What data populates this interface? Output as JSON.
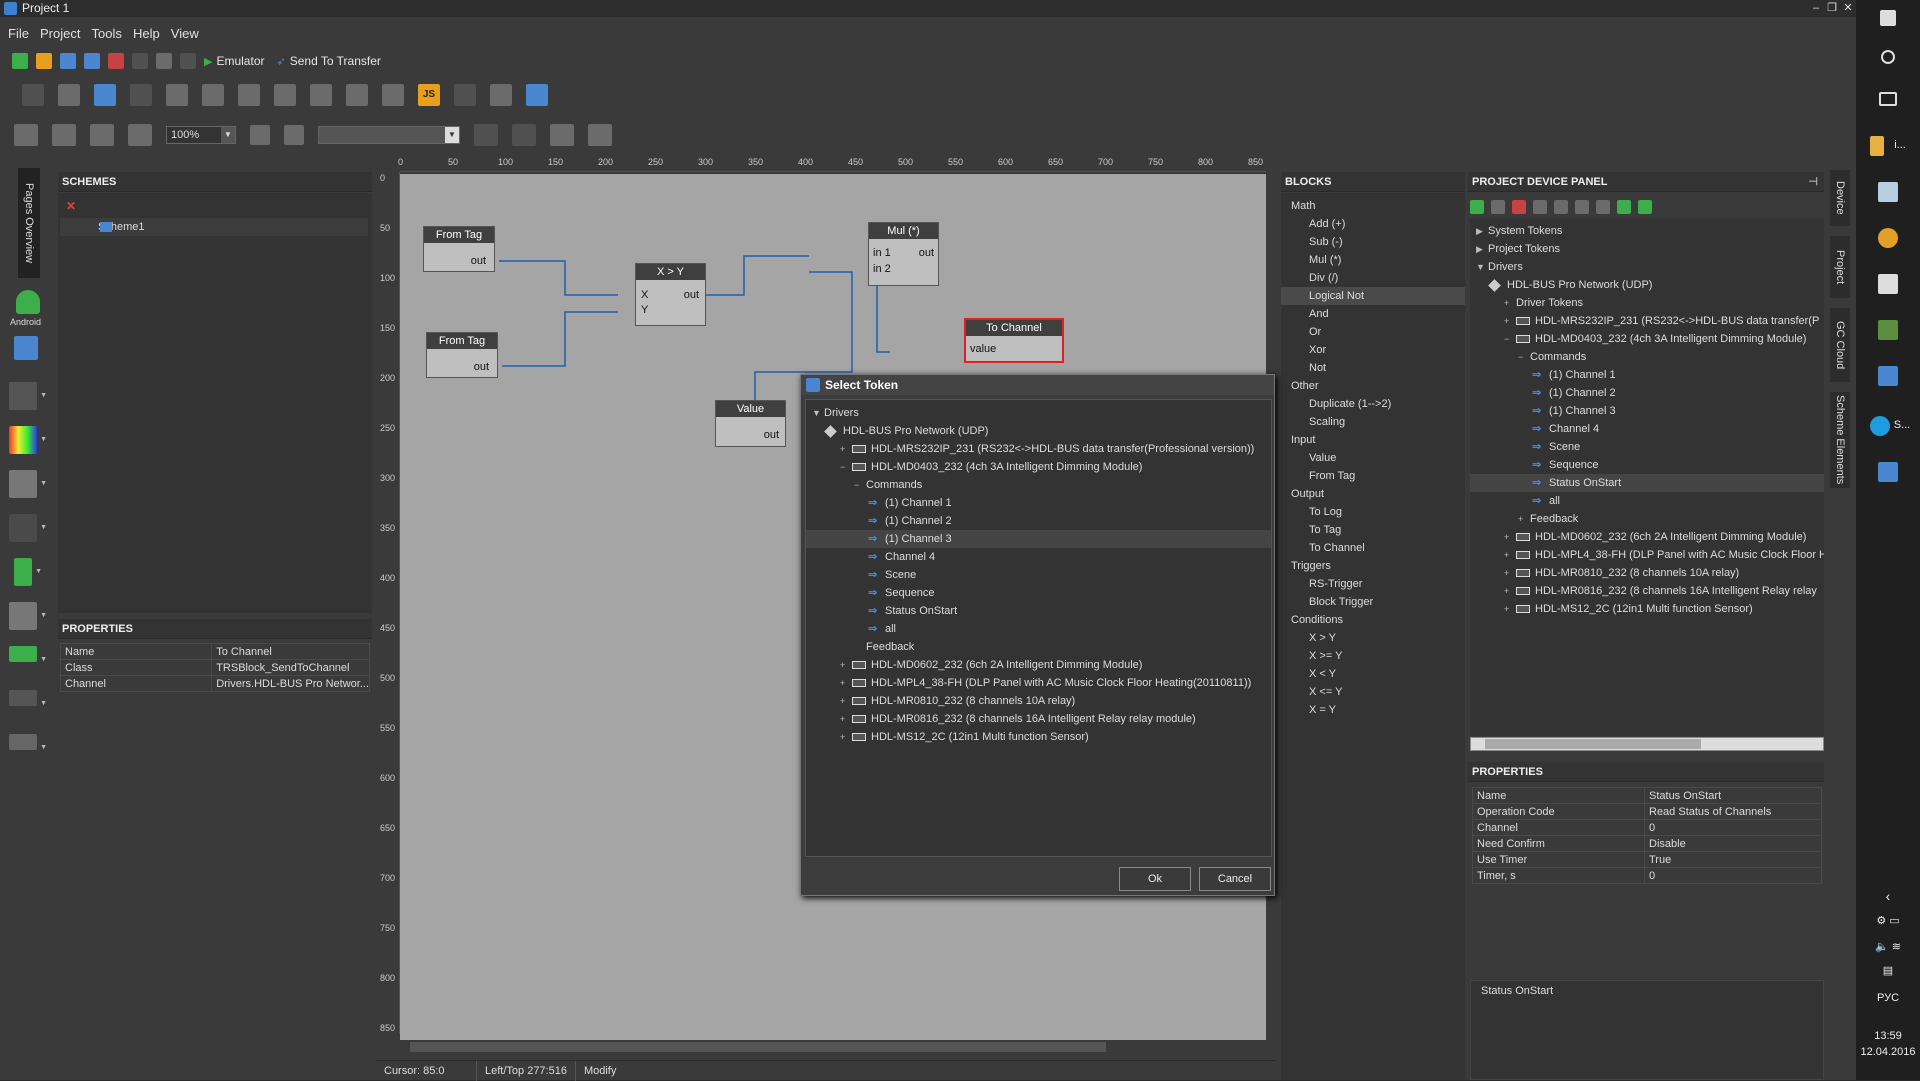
{
  "window": {
    "title": "Project 1"
  },
  "menu": [
    "File",
    "Project",
    "Tools",
    "Help",
    "View"
  ],
  "toolbar": {
    "emulator": "Emulator",
    "send_to_transfer": "Send To Transfer",
    "zoom": "100%",
    "js": "JS"
  },
  "left_tools": {
    "pages_overview": "Pages Overview",
    "android": "Android"
  },
  "schemes": {
    "title": "SCHEMES",
    "items": [
      "Scheme1"
    ]
  },
  "properties_left": {
    "title": "PROPERTIES",
    "rows": [
      {
        "k": "Name",
        "v": "To Channel"
      },
      {
        "k": "Class",
        "v": "TRSBlock_SendToChannel"
      },
      {
        "k": "Channel",
        "v": "Drivers.HDL-BUS Pro Networ..."
      }
    ]
  },
  "ruler": {
    "top": [
      "0",
      "50",
      "100",
      "150",
      "200",
      "250",
      "300",
      "350",
      "400",
      "450",
      "500",
      "550",
      "600",
      "650",
      "700",
      "750",
      "800",
      "850"
    ],
    "left": [
      "0",
      "50",
      "100",
      "150",
      "200",
      "250",
      "300",
      "350",
      "400",
      "450",
      "500",
      "550",
      "600",
      "650",
      "700",
      "750",
      "800",
      "850"
    ]
  },
  "canvas_blocks": {
    "from_tag_1": {
      "title": "From Tag",
      "out": "out"
    },
    "from_tag_2": {
      "title": "From Tag",
      "out": "out"
    },
    "compare": {
      "title": "X > Y",
      "x": "X",
      "y": "Y",
      "out": "out"
    },
    "mul": {
      "title": "Mul (*)",
      "in1": "in 1",
      "in2": "in 2",
      "out": "out"
    },
    "to_channel": {
      "title": "To Channel",
      "value": "value"
    },
    "value": {
      "title": "Value",
      "out": "out"
    }
  },
  "status": {
    "cursor": "Cursor: 85:0",
    "lefttop": "Left/Top 277:516",
    "mode": "Modify"
  },
  "blocks": {
    "title": "BLOCKS",
    "list": [
      {
        "t": "Math",
        "k": "cat"
      },
      {
        "t": "Add (+)",
        "k": "item"
      },
      {
        "t": "Sub (-)",
        "k": "item"
      },
      {
        "t": "Mul (*)",
        "k": "item"
      },
      {
        "t": "Div (/)",
        "k": "item"
      },
      {
        "t": "Logical Not",
        "k": "item"
      },
      {
        "t": "And",
        "k": "item"
      },
      {
        "t": "Or",
        "k": "item"
      },
      {
        "t": "Xor",
        "k": "item"
      },
      {
        "t": "Not",
        "k": "item"
      },
      {
        "t": "Other",
        "k": "cat"
      },
      {
        "t": "Duplicate (1-->2)",
        "k": "item"
      },
      {
        "t": "Scaling",
        "k": "item"
      },
      {
        "t": "Input",
        "k": "cat"
      },
      {
        "t": "Value",
        "k": "item"
      },
      {
        "t": "From Tag",
        "k": "item"
      },
      {
        "t": "Output",
        "k": "cat"
      },
      {
        "t": "To Log",
        "k": "item"
      },
      {
        "t": "To Tag",
        "k": "item"
      },
      {
        "t": "To Channel",
        "k": "item"
      },
      {
        "t": "Triggers",
        "k": "cat"
      },
      {
        "t": "RS-Trigger",
        "k": "item"
      },
      {
        "t": "Block Trigger",
        "k": "item"
      },
      {
        "t": "Conditions",
        "k": "cat"
      },
      {
        "t": "X > Y",
        "k": "item"
      },
      {
        "t": "X >= Y",
        "k": "item"
      },
      {
        "t": "X < Y",
        "k": "item"
      },
      {
        "t": "X <= Y",
        "k": "item"
      },
      {
        "t": "X = Y",
        "k": "item"
      }
    ]
  },
  "device_panel": {
    "title": "PROJECT DEVICE PANEL",
    "tree": [
      {
        "t": "System Tokens",
        "lvl": 1,
        "ic": "exp"
      },
      {
        "t": "Project Tokens",
        "lvl": 1,
        "ic": "exp"
      },
      {
        "t": "Drivers",
        "lvl": 1,
        "ic": "col"
      },
      {
        "t": "HDL-BUS Pro Network (UDP)",
        "lvl": 2,
        "ic": "dia"
      },
      {
        "t": "Driver Tokens",
        "lvl": 3,
        "ic": "plus"
      },
      {
        "t": "HDL-MRS232IP_231 (RS232<->HDL-BUS data transfer(P",
        "lvl": 3,
        "ic": "dev"
      },
      {
        "t": "HDL-MD0403_232 (4ch 3A Intelligent Dimming Module)",
        "lvl": 3,
        "ic": "devo"
      },
      {
        "t": "Commands",
        "lvl": 4,
        "ic": "minus"
      },
      {
        "t": "(1) Channel 1",
        "lvl": 5,
        "ic": "arr"
      },
      {
        "t": "(1) Channel 2",
        "lvl": 5,
        "ic": "arr"
      },
      {
        "t": "(1) Channel 3",
        "lvl": 5,
        "ic": "arr"
      },
      {
        "t": "Channel 4",
        "lvl": 5,
        "ic": "arr"
      },
      {
        "t": "Scene",
        "lvl": 5,
        "ic": "arr"
      },
      {
        "t": "Sequence",
        "lvl": 5,
        "ic": "arr"
      },
      {
        "t": "Status OnStart",
        "lvl": 5,
        "ic": "arr",
        "sel": true
      },
      {
        "t": "all",
        "lvl": 5,
        "ic": "arr"
      },
      {
        "t": "Feedback",
        "lvl": 4,
        "ic": "plus"
      },
      {
        "t": "HDL-MD0602_232 (6ch 2A Intelligent Dimming Module)",
        "lvl": 3,
        "ic": "dev"
      },
      {
        "t": "HDL-MPL4_38-FH (DLP Panel with AC Music Clock Floor H",
        "lvl": 3,
        "ic": "dev"
      },
      {
        "t": "HDL-MR0810_232 (8 channels 10A relay)",
        "lvl": 3,
        "ic": "dev"
      },
      {
        "t": "HDL-MR0816_232 (8 channels 16A Intelligent Relay relay",
        "lvl": 3,
        "ic": "dev"
      },
      {
        "t": "HDL-MS12_2C (12in1 Multi function Sensor)",
        "lvl": 3,
        "ic": "dev"
      }
    ]
  },
  "properties_right": {
    "title": "PROPERTIES",
    "rows": [
      {
        "k": "Name",
        "v": "Status OnStart"
      },
      {
        "k": "Operation Code",
        "v": "Read Status of Channels"
      },
      {
        "k": "Channel",
        "v": "0"
      },
      {
        "k": "Need Confirm",
        "v": "Disable"
      },
      {
        "k": "Use Timer",
        "v": "True"
      },
      {
        "k": "Timer, s",
        "v": "0"
      }
    ],
    "description": "Status OnStart"
  },
  "side_tabs": [
    "Device",
    "Project",
    "GC Cloud",
    "Scheme Elements"
  ],
  "dialog": {
    "title": "Select Token",
    "tree": [
      {
        "t": "Drivers",
        "lvl": 1,
        "ic": "col"
      },
      {
        "t": "HDL-BUS Pro Network (UDP)",
        "lvl": 2,
        "ic": "dia"
      },
      {
        "t": "HDL-MRS232IP_231 (RS232<->HDL-BUS data transfer(Professional version))",
        "lvl": 3,
        "ic": "dev"
      },
      {
        "t": "HDL-MD0403_232 (4ch 3A Intelligent Dimming Module)",
        "lvl": 3,
        "ic": "devo"
      },
      {
        "t": "Commands",
        "lvl": 4,
        "ic": "minus"
      },
      {
        "t": "(1) Channel 1",
        "lvl": 5,
        "ic": "arr"
      },
      {
        "t": "(1) Channel 2",
        "lvl": 5,
        "ic": "arr"
      },
      {
        "t": "(1) Channel 3",
        "lvl": 5,
        "ic": "arr",
        "sel": true
      },
      {
        "t": "Channel 4",
        "lvl": 5,
        "ic": "arr"
      },
      {
        "t": "Scene",
        "lvl": 5,
        "ic": "arr"
      },
      {
        "t": "Sequence",
        "lvl": 5,
        "ic": "arr"
      },
      {
        "t": "Status OnStart",
        "lvl": 5,
        "ic": "arr"
      },
      {
        "t": "all",
        "lvl": 5,
        "ic": "arr"
      },
      {
        "t": "Feedback",
        "lvl": 4,
        "ic": "none"
      },
      {
        "t": "HDL-MD0602_232 (6ch 2A Intelligent Dimming Module)",
        "lvl": 3,
        "ic": "dev"
      },
      {
        "t": "HDL-MPL4_38-FH (DLP Panel with AC Music Clock Floor Heating(20110811))",
        "lvl": 3,
        "ic": "dev"
      },
      {
        "t": "HDL-MR0810_232 (8 channels 10A relay)",
        "lvl": 3,
        "ic": "dev"
      },
      {
        "t": "HDL-MR0816_232 (8 channels 16A Intelligent Relay relay module)",
        "lvl": 3,
        "ic": "dev"
      },
      {
        "t": "HDL-MS12_2C (12in1 Multi function Sensor)",
        "lvl": 3,
        "ic": "dev"
      }
    ],
    "ok": "Ok",
    "cancel": "Cancel"
  },
  "taskbar": {
    "lang": "РУС",
    "time": "13:59",
    "date": "12.04.2016",
    "app_s": "S...",
    "app_i": "i..."
  }
}
